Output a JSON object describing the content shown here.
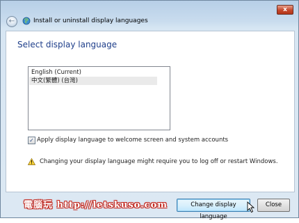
{
  "window": {
    "title": "Install or uninstall display languages",
    "close_label": "x"
  },
  "page": {
    "heading": "Select display language"
  },
  "languages": [
    {
      "label": "English (Current)",
      "selected": false
    },
    {
      "label": "中文(繁體) (台灣)",
      "selected": true
    }
  ],
  "options": {
    "apply_welcome_label": "Apply display language to welcome screen and system accounts",
    "apply_welcome_checked": true,
    "check_mark": "✓"
  },
  "warning": {
    "text": "Changing your display language might require you to log off or restart Windows.",
    "icon": "warning-triangle-icon"
  },
  "watermark": {
    "text": "電腦玩 http://letskuso.com"
  },
  "buttons": {
    "change_label": "Change display language",
    "close_label": "Close"
  },
  "colors": {
    "heading": "#1e3e8a",
    "close_button": "#c4472c",
    "watermark": "#c2271e"
  }
}
